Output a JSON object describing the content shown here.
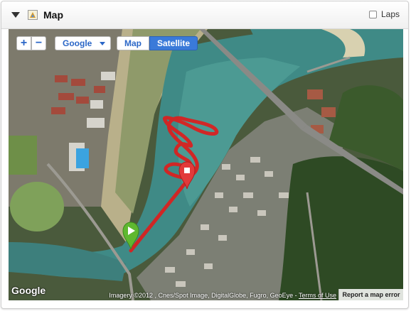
{
  "header": {
    "title": "Map",
    "laps_label": "Laps"
  },
  "map": {
    "zoom_in_label": "+",
    "zoom_out_label": "−",
    "provider": "Google",
    "maptype": {
      "map_label": "Map",
      "satellite_label": "Satellite",
      "active": "Satellite"
    },
    "logo_text": "Google",
    "attribution_text": "Imagery ©2012 , Cnes/Spot Image, DigitalGlobe, Fugro, GeoEye - ",
    "terms_label": "Terms of Use",
    "report_error_label": "Report a map error",
    "colors": {
      "track": "#e01b1b",
      "start_marker": "#5fb830",
      "end_marker": "#e23a3a",
      "satellite_active": "#3a7ad9"
    }
  }
}
